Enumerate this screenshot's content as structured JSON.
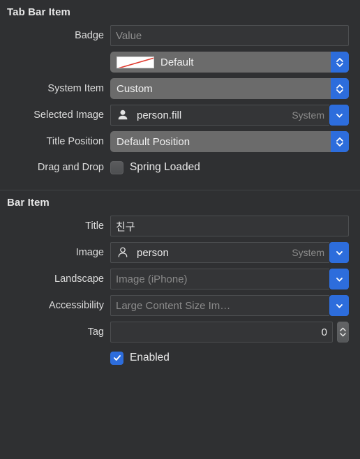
{
  "panel": {
    "background_color": "#2f3032",
    "accent_color": "#2d6ddc"
  },
  "sections": [
    {
      "id": "tab-bar-item",
      "title": "Tab Bar Item",
      "rows": [
        {
          "id": "badge",
          "label": "Badge",
          "type": "textfield",
          "value": "",
          "placeholder": "Value"
        },
        {
          "id": "badge-color",
          "label": "",
          "type": "popup-swatch",
          "value": "Default",
          "swatch_icon": "no-color-swatch-icon",
          "swatch_color": "#ffffff",
          "slash_color": "#e03a2f",
          "chevron_icon": "chevron-up-down-icon"
        },
        {
          "id": "system-item",
          "label": "System Item",
          "type": "popup",
          "value": "Custom",
          "chevron_icon": "chevron-up-down-icon"
        },
        {
          "id": "selected-image",
          "label": "Selected Image",
          "type": "combo",
          "value": "person.fill",
          "suffix": "System",
          "symbol_icon": "person-fill-icon",
          "chevron_icon": "chevron-down-icon",
          "disabled": false
        },
        {
          "id": "title-position",
          "label": "Title Position",
          "type": "popup",
          "value": "Default Position",
          "chevron_icon": "chevron-up-down-icon"
        },
        {
          "id": "drag-and-drop",
          "label": "Drag and Drop",
          "type": "checkbox",
          "checkbox_label": "Spring Loaded",
          "checked": false
        }
      ]
    },
    {
      "id": "bar-item",
      "title": "Bar Item",
      "rows": [
        {
          "id": "title",
          "label": "Title",
          "type": "textfield",
          "value": "친구",
          "placeholder": ""
        },
        {
          "id": "image",
          "label": "Image",
          "type": "combo",
          "value": "person",
          "suffix": "System",
          "symbol_icon": "person-outline-icon",
          "chevron_icon": "chevron-down-icon",
          "disabled": false
        },
        {
          "id": "landscape",
          "label": "Landscape",
          "type": "combo",
          "value": "",
          "placeholder": "Image (iPhone)",
          "suffix": "",
          "symbol_icon": "",
          "chevron_icon": "chevron-down-icon",
          "disabled": true
        },
        {
          "id": "accessibility",
          "label": "Accessibility",
          "type": "combo",
          "value": "",
          "placeholder": "Large Content Size Im…",
          "suffix": "",
          "symbol_icon": "",
          "chevron_icon": "chevron-down-icon",
          "disabled": true
        },
        {
          "id": "tag",
          "label": "Tag",
          "type": "stepper-field",
          "value": "0",
          "stepper_icon": "stepper-up-down-icon"
        },
        {
          "id": "enabled",
          "label": "",
          "type": "checkbox",
          "checkbox_label": "Enabled",
          "checked": true,
          "check_icon": "checkmark-icon"
        }
      ]
    }
  ]
}
